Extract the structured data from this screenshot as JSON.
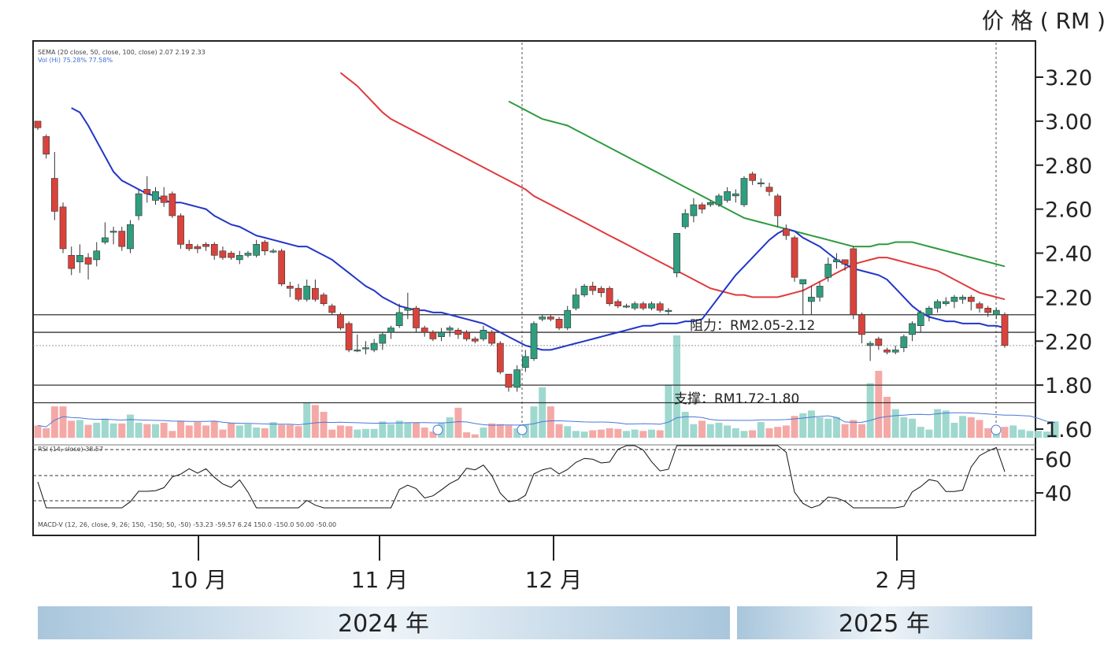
{
  "chart_data": {
    "type": "candlestick",
    "y_unit_label": "价 格 ( RM )",
    "y_ticks": [
      "3.20",
      "3.00",
      "2.80",
      "2.60",
      "2.40",
      "2.20",
      "2.20",
      "1.80",
      "1.60"
    ],
    "rsi_ticks": [
      "60",
      "40"
    ],
    "x_ticks": [
      "10 月",
      "11 月",
      "12 月",
      "2 月"
    ],
    "years": [
      "2024 年",
      "2025 年"
    ],
    "legend_lines": [
      "SEMA (20 close, 50, close, 100, close) 2.07 2.19 2.33",
      "Vol (Hi) 75.28% 77.58%"
    ],
    "rsi_label": "RSI (14, close) 38.57",
    "macd_label": "MACD-V (12, 26, close, 9, 26; 150, -150; 50, -50) -53.23 -59.57 6.24 150.0 -150.0 50.00 -50.00",
    "annotations": {
      "resistance": "阻力：RM2.05-2.12",
      "support": "支撑：RM1.72-1.80"
    },
    "ylim": [
      1.56,
      3.32
    ],
    "levels": [
      2.12,
      2.04,
      1.8,
      1.72
    ],
    "last_price_line": 1.98,
    "candles": [
      [
        3.0,
        2.97,
        3.0,
        2.96
      ],
      [
        2.93,
        2.85,
        2.94,
        2.83
      ],
      [
        2.74,
        2.59,
        2.86,
        2.55
      ],
      [
        2.61,
        2.42,
        2.63,
        2.4
      ],
      [
        2.39,
        2.33,
        2.43,
        2.3
      ],
      [
        2.36,
        2.39,
        2.44,
        2.31
      ],
      [
        2.38,
        2.35,
        2.4,
        2.28
      ],
      [
        2.37,
        2.41,
        2.45,
        2.34
      ],
      [
        2.45,
        2.47,
        2.54,
        2.44
      ],
      [
        2.5,
        2.5,
        2.52,
        2.44
      ],
      [
        2.5,
        2.43,
        2.52,
        2.41
      ],
      [
        2.42,
        2.53,
        2.55,
        2.4
      ],
      [
        2.57,
        2.67,
        2.69,
        2.55
      ],
      [
        2.69,
        2.67,
        2.75,
        2.63
      ],
      [
        2.64,
        2.68,
        2.7,
        2.62
      ],
      [
        2.66,
        2.63,
        2.7,
        2.61
      ],
      [
        2.67,
        2.57,
        2.68,
        2.56
      ],
      [
        2.57,
        2.44,
        2.58,
        2.42
      ],
      [
        2.44,
        2.42,
        2.46,
        2.41
      ],
      [
        2.43,
        2.42,
        2.44,
        2.4
      ],
      [
        2.44,
        2.43,
        2.45,
        2.41
      ],
      [
        2.44,
        2.39,
        2.45,
        2.37
      ],
      [
        2.41,
        2.38,
        2.43,
        2.37
      ],
      [
        2.4,
        2.38,
        2.41,
        2.37
      ],
      [
        2.37,
        2.39,
        2.41,
        2.35
      ],
      [
        2.39,
        2.4,
        2.41,
        2.38
      ],
      [
        2.39,
        2.44,
        2.46,
        2.38
      ],
      [
        2.45,
        2.41,
        2.46,
        2.39
      ],
      [
        2.41,
        2.41,
        2.42,
        2.4
      ],
      [
        2.41,
        2.26,
        2.42,
        2.25
      ],
      [
        2.25,
        2.24,
        2.27,
        2.2
      ],
      [
        2.24,
        2.19,
        2.26,
        2.18
      ],
      [
        2.19,
        2.25,
        2.28,
        2.18
      ],
      [
        2.24,
        2.19,
        2.28,
        2.18
      ],
      [
        2.21,
        2.17,
        2.22,
        2.16
      ],
      [
        2.16,
        2.13,
        2.17,
        2.12
      ],
      [
        2.12,
        2.06,
        2.13,
        2.05
      ],
      [
        2.08,
        1.96,
        2.09,
        1.95
      ],
      [
        1.96,
        1.96,
        2.03,
        1.95
      ],
      [
        1.97,
        1.97,
        2.0,
        1.94
      ],
      [
        1.96,
        1.99,
        2.01,
        1.95
      ],
      [
        1.99,
        2.03,
        2.04,
        1.96
      ],
      [
        2.04,
        2.06,
        2.07,
        2.01
      ],
      [
        2.07,
        2.13,
        2.17,
        2.06
      ],
      [
        2.14,
        2.15,
        2.22,
        2.1
      ],
      [
        2.15,
        2.06,
        2.16,
        2.04
      ],
      [
        2.06,
        2.04,
        2.07,
        2.02
      ],
      [
        2.04,
        2.01,
        2.05,
        2.0
      ],
      [
        2.02,
        2.04,
        2.06,
        2.0
      ],
      [
        2.05,
        2.06,
        2.07,
        2.02
      ],
      [
        2.05,
        2.03,
        2.06,
        2.01
      ],
      [
        2.04,
        2.01,
        2.05,
        2.0
      ],
      [
        2.01,
        2.0,
        2.02,
        1.99
      ],
      [
        2.01,
        2.05,
        2.07,
        2.0
      ],
      [
        2.04,
        1.99,
        2.05,
        1.98
      ],
      [
        1.99,
        1.86,
        2.0,
        1.85
      ],
      [
        1.85,
        1.79,
        1.85,
        1.77
      ],
      [
        1.79,
        1.87,
        1.89,
        1.77
      ],
      [
        1.88,
        1.93,
        1.96,
        1.86
      ],
      [
        1.92,
        2.08,
        2.09,
        1.91
      ],
      [
        2.1,
        2.11,
        2.12,
        2.09
      ],
      [
        2.11,
        2.1,
        2.12,
        2.09
      ],
      [
        2.1,
        2.06,
        2.11,
        2.05
      ],
      [
        2.06,
        2.14,
        2.16,
        2.05
      ],
      [
        2.15,
        2.21,
        2.24,
        2.14
      ],
      [
        2.21,
        2.25,
        2.26,
        2.2
      ],
      [
        2.25,
        2.23,
        2.27,
        2.21
      ],
      [
        2.24,
        2.22,
        2.25,
        2.2
      ],
      [
        2.24,
        2.17,
        2.25,
        2.16
      ],
      [
        2.18,
        2.16,
        2.19,
        2.15
      ],
      [
        2.16,
        2.16,
        2.17,
        2.15
      ],
      [
        2.15,
        2.17,
        2.18,
        2.14
      ],
      [
        2.17,
        2.15,
        2.18,
        2.14
      ],
      [
        2.15,
        2.17,
        2.18,
        2.14
      ],
      [
        2.17,
        2.14,
        2.18,
        2.13
      ],
      [
        2.14,
        2.14,
        2.15,
        2.12
      ],
      [
        2.31,
        2.49,
        2.49,
        2.29
      ],
      [
        2.52,
        2.58,
        2.6,
        2.51
      ],
      [
        2.57,
        2.62,
        2.65,
        2.54
      ],
      [
        2.62,
        2.6,
        2.63,
        2.58
      ],
      [
        2.62,
        2.63,
        2.64,
        2.61
      ],
      [
        2.62,
        2.66,
        2.67,
        2.61
      ],
      [
        2.64,
        2.68,
        2.7,
        2.63
      ],
      [
        2.66,
        2.67,
        2.69,
        2.63
      ],
      [
        2.62,
        2.74,
        2.75,
        2.61
      ],
      [
        2.76,
        2.73,
        2.77,
        2.71
      ],
      [
        2.72,
        2.72,
        2.74,
        2.7
      ],
      [
        2.7,
        2.68,
        2.72,
        2.66
      ],
      [
        2.66,
        2.57,
        2.67,
        2.52
      ],
      [
        2.51,
        2.48,
        2.53,
        2.46
      ],
      [
        2.47,
        2.29,
        2.48,
        2.27
      ],
      [
        2.26,
        2.28,
        2.28,
        2.12
      ],
      [
        2.18,
        2.2,
        2.25,
        2.12
      ],
      [
        2.2,
        2.25,
        2.27,
        2.18
      ],
      [
        2.29,
        2.35,
        2.38,
        2.27
      ],
      [
        2.36,
        2.37,
        2.4,
        2.33
      ],
      [
        2.37,
        2.35,
        2.37,
        2.32
      ],
      [
        2.42,
        2.12,
        2.43,
        2.1
      ],
      [
        2.12,
        2.03,
        2.13,
        1.99
      ],
      [
        1.98,
        1.99,
        2.0,
        1.91
      ],
      [
        2.01,
        1.98,
        2.02,
        1.96
      ],
      [
        1.96,
        1.95,
        1.97,
        1.94
      ],
      [
        1.95,
        1.96,
        1.98,
        1.94
      ],
      [
        1.97,
        2.02,
        2.03,
        1.95
      ],
      [
        2.03,
        2.08,
        2.09,
        2.0
      ],
      [
        2.07,
        2.13,
        2.14,
        2.04
      ],
      [
        2.12,
        2.15,
        2.16,
        2.09
      ],
      [
        2.15,
        2.18,
        2.19,
        2.13
      ],
      [
        2.17,
        2.18,
        2.2,
        2.16
      ],
      [
        2.18,
        2.2,
        2.21,
        2.15
      ],
      [
        2.19,
        2.2,
        2.21,
        2.17
      ],
      [
        2.2,
        2.18,
        2.21,
        2.14
      ],
      [
        2.17,
        2.15,
        2.18,
        2.13
      ],
      [
        2.15,
        2.13,
        2.16,
        2.11
      ],
      [
        2.12,
        2.14,
        2.15,
        2.1
      ],
      [
        2.12,
        1.98,
        2.13,
        1.97
      ]
    ],
    "ema20": [
      3.06,
      3.04,
      2.98,
      2.91,
      2.84,
      2.77,
      2.73,
      2.71,
      2.69,
      2.67,
      2.66,
      2.64,
      2.63,
      2.63,
      2.62,
      2.61,
      2.6,
      2.57,
      2.55,
      2.53,
      2.52,
      2.5,
      2.48,
      2.47,
      2.46,
      2.45,
      2.44,
      2.43,
      2.43,
      2.41,
      2.39,
      2.37,
      2.34,
      2.31,
      2.28,
      2.25,
      2.23,
      2.2,
      2.18,
      2.16,
      2.15,
      2.14,
      2.14,
      2.13,
      2.13,
      2.12,
      2.11,
      2.1,
      2.09,
      2.08,
      2.06,
      2.04,
      2.02,
      2.0,
      1.98,
      1.97,
      1.96,
      1.96,
      1.97,
      1.98,
      1.99,
      2.0,
      2.01,
      2.02,
      2.03,
      2.04,
      2.05,
      2.06,
      2.07,
      2.07,
      2.08,
      2.08,
      2.08,
      2.09,
      2.09,
      2.1,
      2.15,
      2.2,
      2.25,
      2.3,
      2.34,
      2.38,
      2.42,
      2.46,
      2.49,
      2.51,
      2.5,
      2.47,
      2.45,
      2.43,
      2.4,
      2.37,
      2.35,
      2.33,
      2.32,
      2.31,
      2.3,
      2.28,
      2.24,
      2.2,
      2.16,
      2.13,
      2.11,
      2.1,
      2.09,
      2.09,
      2.08,
      2.08,
      2.08,
      2.07,
      2.07,
      2.06
    ],
    "ema50": [
      3.22,
      3.19,
      3.16,
      3.12,
      3.08,
      3.04,
      3.01,
      2.99,
      2.97,
      2.95,
      2.93,
      2.91,
      2.89,
      2.87,
      2.85,
      2.83,
      2.81,
      2.79,
      2.77,
      2.75,
      2.73,
      2.71,
      2.69,
      2.66,
      2.64,
      2.62,
      2.6,
      2.58,
      2.56,
      2.54,
      2.52,
      2.5,
      2.48,
      2.46,
      2.44,
      2.42,
      2.4,
      2.38,
      2.36,
      2.34,
      2.32,
      2.3,
      2.28,
      2.26,
      2.24,
      2.23,
      2.22,
      2.21,
      2.21,
      2.2,
      2.2,
      2.2,
      2.2,
      2.21,
      2.22,
      2.23,
      2.25,
      2.27,
      2.29,
      2.31,
      2.33,
      2.35,
      2.36,
      2.37,
      2.38,
      2.38,
      2.37,
      2.36,
      2.35,
      2.34,
      2.33,
      2.32,
      2.3,
      2.28,
      2.26,
      2.24,
      2.22,
      2.21,
      2.2,
      2.19
    ],
    "ema100": [
      3.09,
      3.07,
      3.05,
      3.03,
      3.01,
      3.0,
      2.99,
      2.98,
      2.96,
      2.94,
      2.92,
      2.9,
      2.88,
      2.86,
      2.84,
      2.82,
      2.8,
      2.78,
      2.76,
      2.74,
      2.72,
      2.7,
      2.68,
      2.66,
      2.64,
      2.62,
      2.6,
      2.58,
      2.56,
      2.55,
      2.54,
      2.53,
      2.52,
      2.51,
      2.5,
      2.49,
      2.48,
      2.47,
      2.46,
      2.45,
      2.44,
      2.43,
      2.43,
      2.43,
      2.44,
      2.44,
      2.45,
      2.45,
      2.45,
      2.44,
      2.43,
      2.42,
      2.41,
      2.4,
      2.39,
      2.38,
      2.37,
      2.36,
      2.35,
      2.34
    ],
    "volume": [
      18,
      14,
      46,
      46,
      25,
      26,
      19,
      22,
      28,
      21,
      21,
      34,
      22,
      20,
      20,
      22,
      10,
      25,
      18,
      23,
      18,
      24,
      12,
      22,
      18,
      20,
      15,
      14,
      23,
      19,
      19,
      17,
      52,
      48,
      38,
      12,
      18,
      17,
      12,
      13,
      13,
      24,
      20,
      25,
      22,
      22,
      15,
      9,
      22,
      30,
      44,
      8,
      5,
      15,
      21,
      20,
      18,
      14,
      20,
      46,
      74,
      46,
      20,
      17,
      10,
      9,
      11,
      12,
      14,
      13,
      10,
      12,
      10,
      12,
      11,
      78,
      150,
      38,
      20,
      25,
      20,
      22,
      18,
      14,
      10,
      11,
      23,
      14,
      16,
      18,
      32,
      36,
      40,
      30,
      28,
      30,
      20,
      26,
      20,
      80,
      98,
      60,
      42,
      30,
      28,
      16,
      12,
      42,
      40,
      22,
      32,
      30,
      26,
      14,
      10,
      16,
      18,
      12,
      10,
      10,
      9,
      24
    ]
  }
}
